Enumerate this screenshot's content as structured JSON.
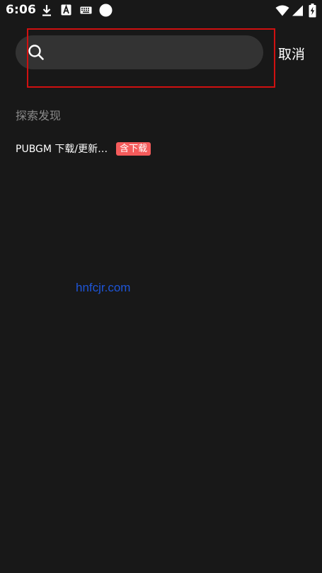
{
  "status_bar": {
    "time": "6:06",
    "left_icons": [
      "download-icon",
      "a-badge-icon",
      "keyboard-icon",
      "circle-icon"
    ],
    "right_icons": [
      "wifi-icon",
      "signal-icon",
      "battery-charging-icon"
    ]
  },
  "search": {
    "placeholder": "",
    "value": "",
    "cancel_label": "取消"
  },
  "discover": {
    "title": "探索发现",
    "items": [
      {
        "label": "PUBGM 下载/更新…",
        "badge": "含下载",
        "badge_color": "#f45b5b"
      }
    ]
  },
  "watermark": "hnfcjr.com",
  "colors": {
    "background": "#181818",
    "search_bg": "#333333",
    "highlight": "#d01010",
    "watermark": "#1e55d8"
  }
}
